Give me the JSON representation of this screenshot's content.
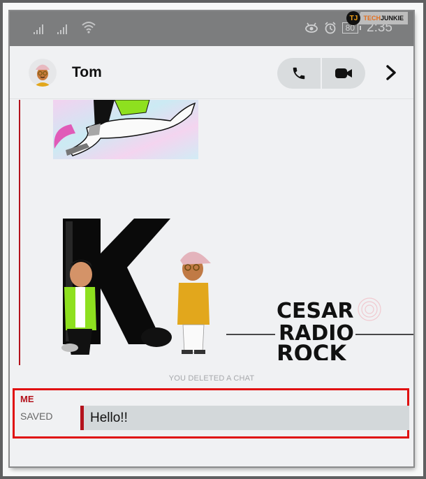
{
  "status_bar": {
    "time": "2:35",
    "battery": "80",
    "icons": [
      "signal-icon",
      "signal-icon",
      "wifi-icon",
      "eye-icon",
      "alarm-icon",
      "battery-icon"
    ]
  },
  "watermark_top": {
    "logo": "TJ",
    "brand_a": "TECH",
    "brand_b": "JUNKIE"
  },
  "header": {
    "contact_name": "Tom",
    "buttons": [
      "phone-call",
      "video-call",
      "chevron-right"
    ]
  },
  "chat": {
    "system_message": "YOU DELETED A CHAT",
    "saved_message": {
      "sender": "ME",
      "status": "SAVED",
      "text": "Hello!!"
    }
  },
  "watermark_bottom": {
    "line1": "CESAR",
    "line2": "RADIO",
    "line3": "ROCK"
  },
  "colors": {
    "accent_red": "#b3121c",
    "highlight_box": "#e01010",
    "statusbar": "#7c7d7e"
  }
}
